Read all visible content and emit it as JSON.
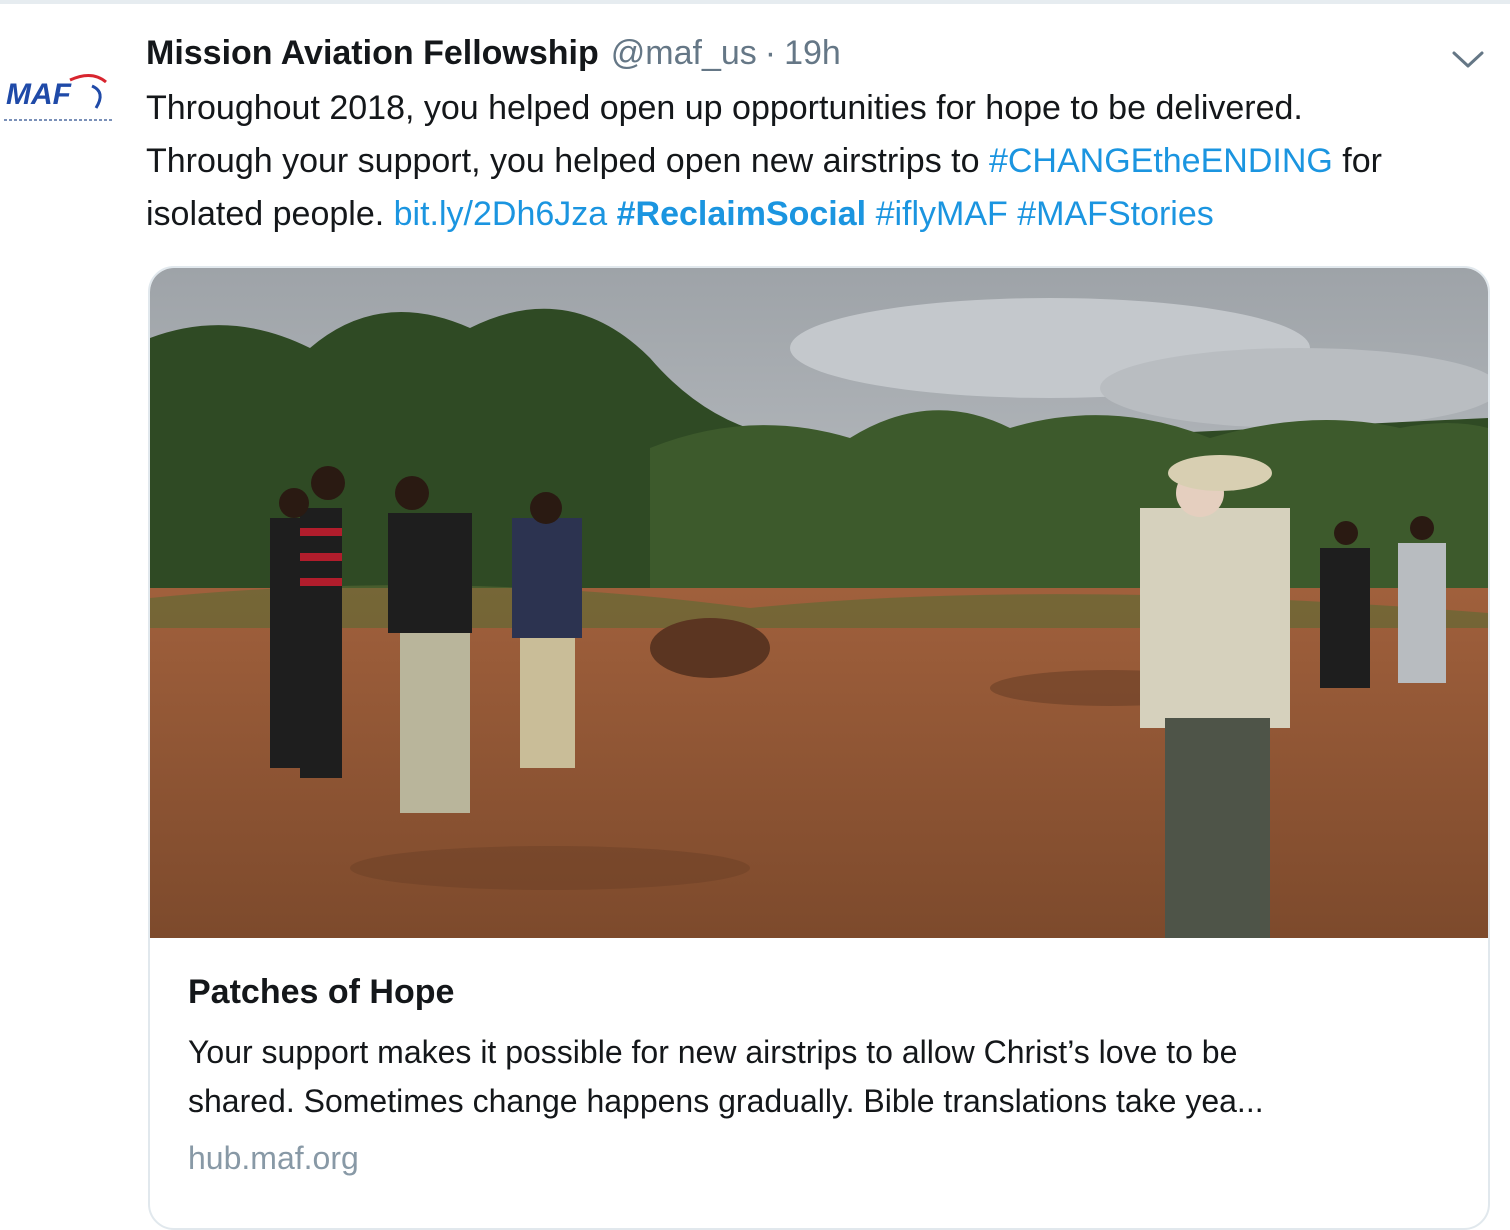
{
  "author": {
    "display_name": "Mission Aviation Fellowship",
    "handle": "@maf_us",
    "separator": "·",
    "time": "19h",
    "avatar_logo_text": "MAF"
  },
  "tweet": {
    "line1": "Throughout 2018, you helped open up opportunities for hope to be delivered.",
    "line2_prefix": "Through your support, you helped open new airstrips to ",
    "hashtag_change": "#CHANGEtheENDING",
    "line2_suffix": " for",
    "line3_prefix": "isolated people. ",
    "short_link": "bit.ly/2Dh6Jza",
    "hashtag_reclaim": "#ReclaimSocial",
    "hashtag_iflymaf": "#iflyMAF",
    "hashtag_mafstories": "#MAFStories"
  },
  "card": {
    "title": "Patches of Hope",
    "description_line1": "Your support makes it possible for new airstrips to allow Christ’s love to be",
    "description_line2": "shared. Sometimes change happens gradually. Bible translations take yea...",
    "domain": "hub.maf.org"
  },
  "icons": {
    "caret": "chevron-down-icon",
    "avatar": "maf-logo"
  },
  "colors": {
    "link": "#1b95e0",
    "text": "#14171a",
    "secondary": "#657786",
    "domain": "#8899a6",
    "border": "#e1e8ed",
    "logo_blue": "#1f4aa8",
    "logo_red": "#d8252f"
  }
}
